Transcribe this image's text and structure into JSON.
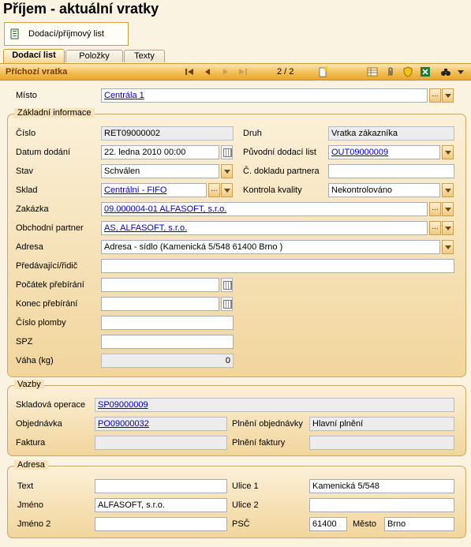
{
  "title": "Příjem - aktuální vratky",
  "doc_button": "Dodací/příjmový list",
  "tabs": [
    "Dodací list",
    "Položky",
    "Texty"
  ],
  "bar": {
    "title": "Příchozí vratka",
    "pager": "2 / 2"
  },
  "misto": {
    "label": "Místo",
    "value": "Centrála 1"
  },
  "zakladni": {
    "title": "Základní informace",
    "cislo": {
      "label": "Číslo",
      "value": "RET09000002"
    },
    "druh": {
      "label": "Druh",
      "value": "Vratka zákazníka"
    },
    "datum": {
      "label": "Datum dodání",
      "value": "22. ledna 2010 00:00"
    },
    "puvodni": {
      "label": "Původní dodací list",
      "value": "OUT09000009"
    },
    "stav": {
      "label": "Stav",
      "value": "Schválen"
    },
    "doklad_partnera": {
      "label": "Č. dokladu partnera",
      "value": ""
    },
    "sklad": {
      "label": "Sklad",
      "value": "Centrální - FIFO"
    },
    "kontrola": {
      "label": "Kontrola kvality",
      "value": "Nekontrolováno"
    },
    "zakazka": {
      "label": "Zakázka",
      "value": "09.000004-01 ALFASOFT, s.r.o."
    },
    "partner": {
      "label": "Obchodní partner",
      "value": "AS, ALFASOFT, s.r.o."
    },
    "adresa": {
      "label": "Adresa",
      "value": "Adresa - sídlo (Kamenická 5/548 61400 Brno )"
    },
    "ridic": {
      "label": "Předávající/řidič",
      "value": ""
    },
    "pocatek": {
      "label": "Počátek přebírání",
      "value": ""
    },
    "konec": {
      "label": "Konec přebírání",
      "value": ""
    },
    "plomba": {
      "label": "Číslo plomby",
      "value": ""
    },
    "spz": {
      "label": "SPZ",
      "value": ""
    },
    "vaha": {
      "label": "Váha (kg)",
      "value": "0"
    }
  },
  "vazby": {
    "title": "Vazby",
    "skladova": {
      "label": "Skladová operace",
      "value": "SP09000009"
    },
    "objednavka": {
      "label": "Objednávka",
      "value": "PO09000032"
    },
    "plneni_obj": {
      "label": "Plnění objednávky",
      "value": "Hlavní plnění"
    },
    "faktura": {
      "label": "Faktura",
      "value": ""
    },
    "plneni_fakt": {
      "label": "Plnění faktury",
      "value": ""
    }
  },
  "adresa": {
    "title": "Adresa",
    "text": {
      "label": "Text",
      "value": ""
    },
    "ulice1": {
      "label": "Ulice 1",
      "value": "Kamenická 5/548"
    },
    "jmeno": {
      "label": "Jméno",
      "value": "ALFASOFT, s.r.o."
    },
    "ulice2": {
      "label": "Ulice 2",
      "value": ""
    },
    "jmeno2": {
      "label": "Jméno 2",
      "value": ""
    },
    "psc": {
      "label": "PSČ",
      "value": "61400"
    },
    "mesto": {
      "label": "Město",
      "value": "Brno"
    }
  }
}
